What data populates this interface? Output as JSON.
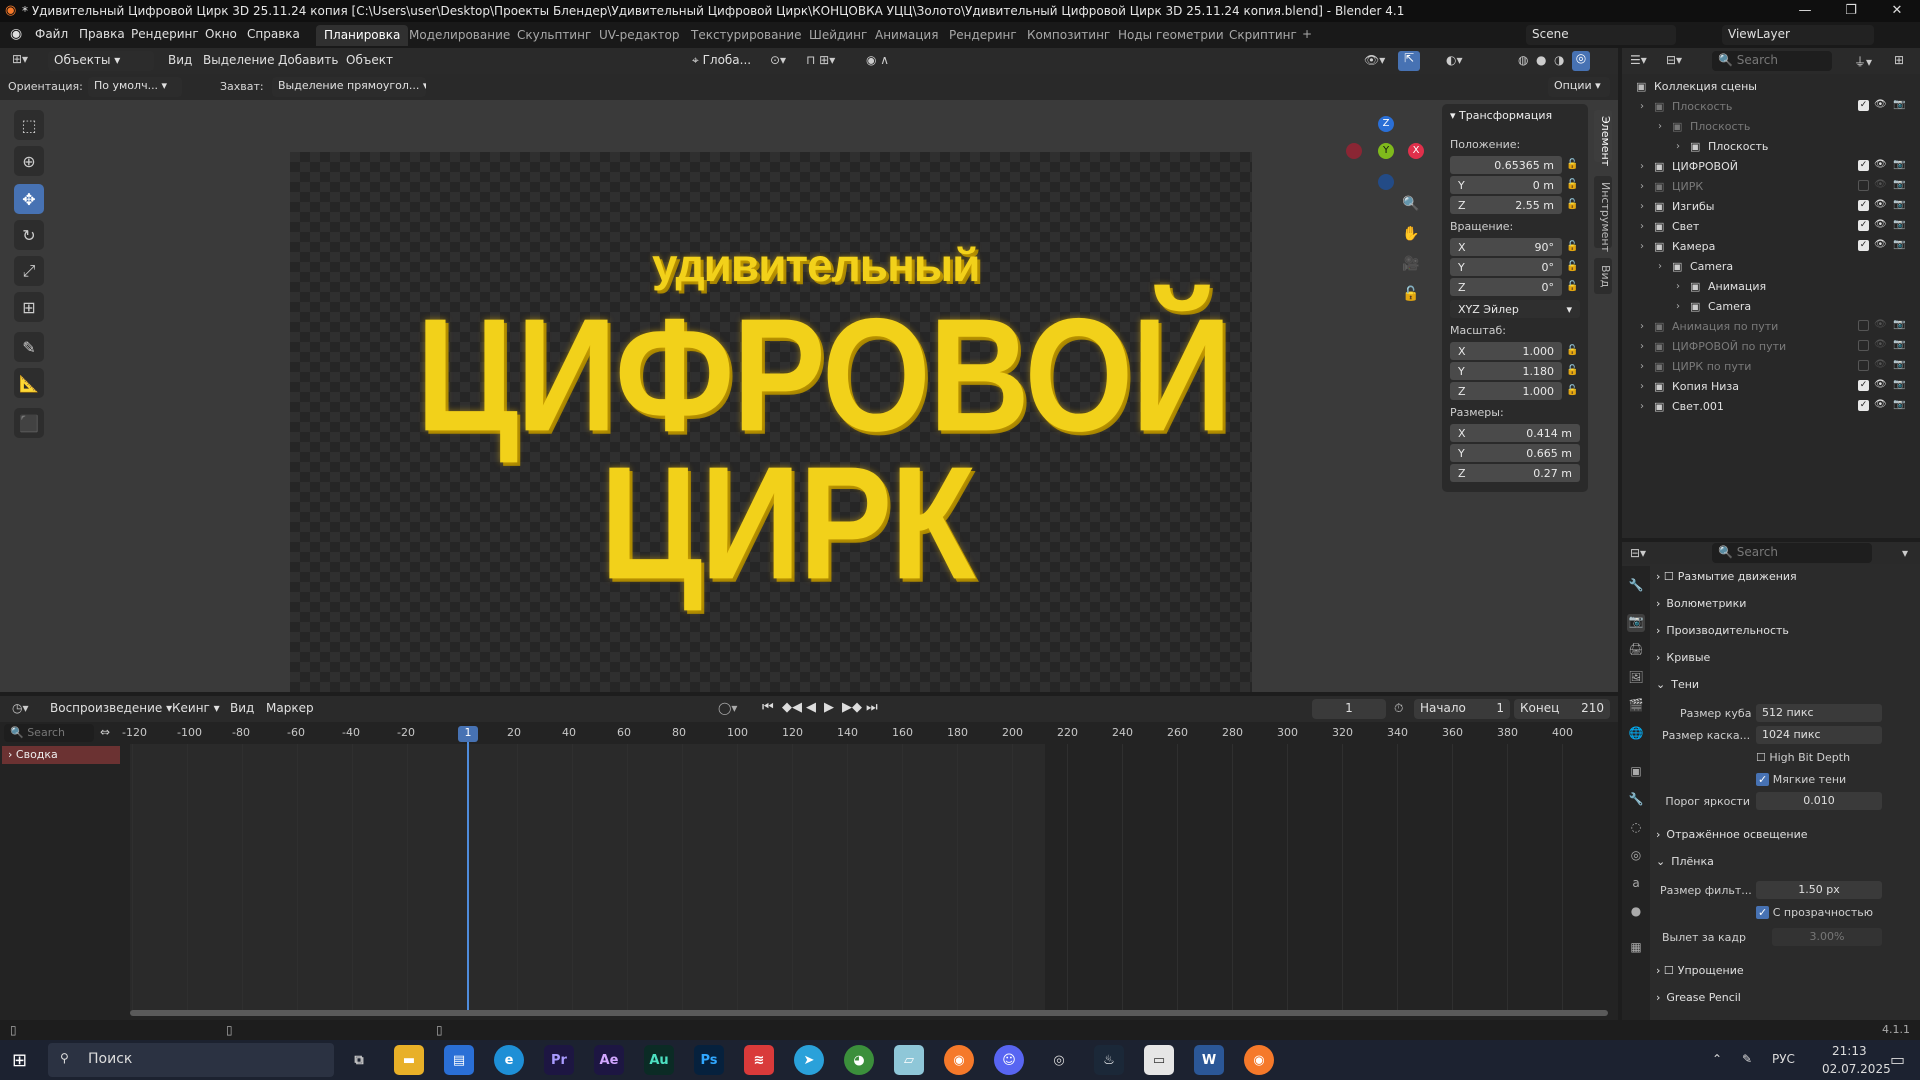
{
  "window": {
    "title": "* Удивительный Цифровой Цирк 3D 25.11.24 копия [C:\\Users\\user\\Desktop\\Проекты Блендер\\Удивительный Цифровой Цирк\\КОНЦОВКА УЦЦ\\Золото\\Удивительный Цифровой Цирк 3D 25.11.24 копия.blend] - Blender 4.1",
    "minimize": "—",
    "maximize": "❐",
    "close": "✕"
  },
  "menu": {
    "items": [
      "Файл",
      "Правка",
      "Рендеринг",
      "Окно",
      "Справка"
    ],
    "workspaces": [
      "Планировка",
      "Моделирование",
      "Скульптинг",
      "UV-редактор",
      "Текстурирование",
      "Шейдинг",
      "Анимация",
      "Рендеринг",
      "Композитинг",
      "Ноды геометрии",
      "Скриптинг"
    ],
    "add_tab": "+",
    "scene": "Scene",
    "view_layer": "ViewLayer"
  },
  "viewport": {
    "mode": "Объекты",
    "menu": [
      "Вид",
      "Выделение",
      "Добавить",
      "Объект"
    ],
    "transform_orientation": "Глоба...",
    "orientation_label": "Ориентация:",
    "orientation_value": "По умолч...",
    "snap_label": "Захват:",
    "snap_value": "Выделение прямоугол...",
    "options": "Опции",
    "text_line1": "удивительный",
    "text_line2": "ЦИФРОВОЙ",
    "text_line3": "ЦИРК",
    "gizmo": {
      "x": "X",
      "y": "Y",
      "z": "Z"
    }
  },
  "npanel": {
    "section": "Трансформация",
    "location_label": "Положение:",
    "location": [
      {
        "axis": "",
        "value": "0.65365 m"
      },
      {
        "axis": "Y",
        "value": "0 m"
      },
      {
        "axis": "Z",
        "value": "2.55 m"
      }
    ],
    "rotation_label": "Вращение:",
    "rotation": [
      {
        "axis": "X",
        "value": "90°"
      },
      {
        "axis": "Y",
        "value": "0°"
      },
      {
        "axis": "Z",
        "value": "0°"
      }
    ],
    "rotation_mode": "XYZ Эйлер",
    "scale_label": "Масштаб:",
    "scale": [
      {
        "axis": "X",
        "value": "1.000"
      },
      {
        "axis": "Y",
        "value": "1.180"
      },
      {
        "axis": "Z",
        "value": "1.000"
      }
    ],
    "dimensions_label": "Размеры:",
    "dimensions": [
      {
        "axis": "X",
        "value": "0.414 m"
      },
      {
        "axis": "Y",
        "value": "0.665 m"
      },
      {
        "axis": "Z",
        "value": "0.27 m"
      }
    ],
    "tabs": [
      "Элемент",
      "Инструмент",
      "Вид"
    ]
  },
  "outliner": {
    "search_placeholder": "Search",
    "root": "Коллекция сцены",
    "rows": [
      {
        "name": "Плоскость",
        "indent": 1,
        "dim": true,
        "check": true
      },
      {
        "name": "Плоскость",
        "indent": 2,
        "dim": true,
        "check": null
      },
      {
        "name": "Плоскость",
        "indent": 3,
        "dim": false,
        "check": null
      },
      {
        "name": "ЦИФРОВОЙ",
        "indent": 1,
        "dim": false,
        "check": true
      },
      {
        "name": "ЦИРК",
        "indent": 1,
        "dim": true,
        "check": false
      },
      {
        "name": "Изгибы",
        "indent": 1,
        "dim": false,
        "check": true
      },
      {
        "name": "Свет",
        "indent": 1,
        "dim": false,
        "check": true
      },
      {
        "name": "Камера",
        "indent": 1,
        "dim": false,
        "check": true
      },
      {
        "name": "Camera",
        "indent": 2,
        "dim": false,
        "check": null
      },
      {
        "name": "Анимация",
        "indent": 3,
        "dim": false,
        "check": null
      },
      {
        "name": "Camera",
        "indent": 3,
        "dim": false,
        "check": null
      },
      {
        "name": "Анимация по пути",
        "indent": 1,
        "dim": true,
        "check": false
      },
      {
        "name": "ЦИФРОВОЙ по пути",
        "indent": 1,
        "dim": true,
        "check": false
      },
      {
        "name": "ЦИРК по пути",
        "indent": 1,
        "dim": true,
        "check": false
      },
      {
        "name": "Копия Низа",
        "indent": 1,
        "dim": false,
        "check": true
      },
      {
        "name": "Свет.001",
        "indent": 1,
        "dim": false,
        "check": true
      }
    ]
  },
  "properties": {
    "search_placeholder": "Search",
    "panels": [
      "Размытие движения",
      "Волюметрики",
      "Производительность",
      "Кривые",
      "Тени"
    ],
    "shadows": {
      "cube_size_label": "Размер куба",
      "cube_size": "512 пикс",
      "cascade_label": "Размер каска...",
      "cascade": "1024 пикс",
      "high_bit": "High Bit Depth",
      "soft": "Мягкие тени",
      "threshold_label": "Порог яркости",
      "threshold": "0.010"
    },
    "indirect": "Отражённое освещение",
    "film": "Плёнка",
    "filter_label": "Размер фильт...",
    "filter": "1.50 px",
    "transparent": "С прозрачностью",
    "overscan_label": "Вылет за кадр",
    "overscan": "3.00%",
    "simplify": "Упрощение",
    "grease": "Grease Pencil"
  },
  "timeline": {
    "playback": "Воспроизведение",
    "keying": "Кеинг",
    "view": "Вид",
    "marker": "Маркер",
    "current_frame": "1",
    "start_label": "Начало",
    "start": "1",
    "end_label": "Конец",
    "end": "210",
    "search_placeholder": "Search",
    "summary": "Сводка",
    "ticks": [
      "-120",
      "-100",
      "-80",
      "-60",
      "-40",
      "-20",
      "1",
      "20",
      "40",
      "60",
      "80",
      "100",
      "120",
      "140",
      "160",
      "180",
      "200",
      "220",
      "240",
      "260",
      "280",
      "300",
      "320",
      "340",
      "360",
      "380",
      "400"
    ]
  },
  "status": {
    "version": "4.1.1"
  },
  "taskbar": {
    "search": "Поиск",
    "lang": "РУС",
    "time": "21:13",
    "date": "02.07.2025",
    "apps": [
      "Pr",
      "Ae",
      "Au",
      "Ps"
    ]
  }
}
